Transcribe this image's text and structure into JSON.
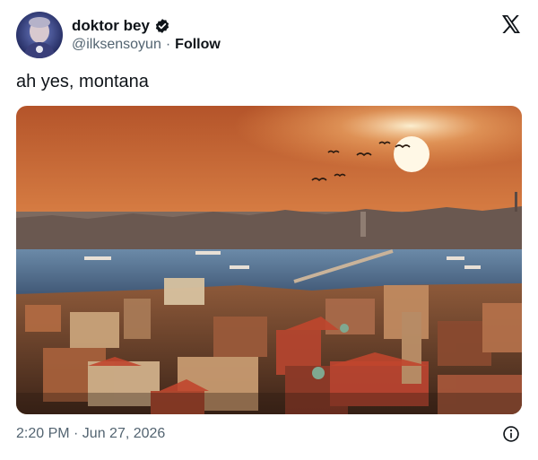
{
  "author": {
    "display_name": "doktor bey",
    "handle": "@ilksensoyun",
    "separator": "·",
    "follow_label": "Follow",
    "avatar_icon": "avatar-photo",
    "verified_icon": "verified-badge-icon"
  },
  "platform": {
    "logo_icon": "x-logo-icon"
  },
  "tweet": {
    "text": "ah yes, montana",
    "media_description_icon": "city-sunset-photo"
  },
  "footer": {
    "timestamp": "2:20 PM · Jun 27, 2026",
    "info_icon": "info-icon"
  },
  "colors": {
    "text_primary": "#0f1419",
    "text_secondary": "#536471",
    "verified_blue": "#1d9bf0"
  }
}
